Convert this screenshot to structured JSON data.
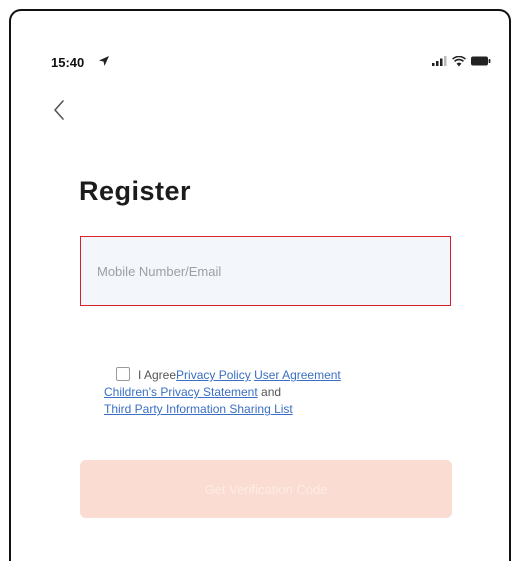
{
  "status_bar": {
    "time": "15:40",
    "icons": [
      "location-arrow-icon",
      "signal-icon",
      "wifi-icon",
      "battery-icon"
    ]
  },
  "nav": {
    "back_icon": "chevron-left-icon"
  },
  "page": {
    "title": "Register"
  },
  "form": {
    "account_placeholder": "Mobile Number/Email",
    "account_value": "",
    "input_border_color": "#d8202f"
  },
  "agreement": {
    "checked": false,
    "prefix": "I Agree",
    "privacy_policy": "Privacy Policy",
    "user_agreement": "User Agreement",
    "childrens_privacy": "Children's Privacy Statement",
    "and": "and",
    "third_party": "Third Party Information Sharing List",
    "link_color": "#3a6fc4"
  },
  "submit": {
    "label": "Get Verification Code",
    "enabled": false,
    "color": "#fbdcd2"
  }
}
